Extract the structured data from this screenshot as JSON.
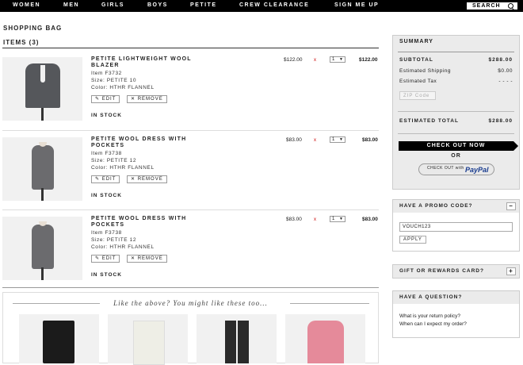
{
  "nav": {
    "items": [
      "WOMEN",
      "MEN",
      "GIRLS",
      "BOYS",
      "PETITE",
      "CREW CLEARANCE",
      "SIGN ME UP"
    ],
    "search_label": "SEARCH"
  },
  "page": {
    "title": "SHOPPING BAG",
    "items_label": "ITEMS (3)"
  },
  "items": [
    {
      "name": "PETITE LIGHTWEIGHT WOOL BLAZER",
      "item_no": "Item F3732",
      "size": "Size: PETITE 10",
      "color": "Color: HTHR FLANNEL",
      "price": "$122.00",
      "qty": "1",
      "total": "$122.00",
      "stock": "IN STOCK",
      "edit": "EDIT",
      "remove": "REMOVE",
      "image": "blazer"
    },
    {
      "name": "PETITE WOOL DRESS WITH POCKETS",
      "item_no": "Item F3738",
      "size": "Size: PETITE 12",
      "color": "Color: HTHR FLANNEL",
      "price": "$83.00",
      "qty": "1",
      "total": "$83.00",
      "stock": "IN STOCK",
      "edit": "EDIT",
      "remove": "REMOVE",
      "image": "dress"
    },
    {
      "name": "PETITE WOOL DRESS WITH POCKETS",
      "item_no": "Item F3738",
      "size": "Size: PETITE 12",
      "color": "Color: HTHR FLANNEL",
      "price": "$83.00",
      "qty": "1",
      "total": "$83.00",
      "stock": "IN STOCK",
      "edit": "EDIT",
      "remove": "REMOVE",
      "image": "dress"
    }
  ],
  "times_symbol": "x",
  "reco": {
    "title": "Like the above? You might like these too...",
    "colors": [
      "#1b1b1b",
      "#eeeee6",
      "#2a2a2a",
      "#e58a9a"
    ]
  },
  "summary": {
    "title": "SUMMARY",
    "subtotal_label": "SUBTOTAL",
    "subtotal": "$288.00",
    "shipping_label": "Estimated Shipping",
    "shipping": "$0.00",
    "tax_label": "Estimated Tax",
    "tax": "- - - -",
    "zip_placeholder": "ZIP Code",
    "total_label": "ESTIMATED TOTAL",
    "total": "$288.00",
    "checkout_label": "CHECK OUT NOW",
    "or_label": "OR",
    "paypal_pre": "CHECK OUT with",
    "paypal_brand": "PayPal"
  },
  "promo": {
    "title": "HAVE A PROMO CODE?",
    "toggle": "−",
    "code": "VOUCH123",
    "apply": "APPLY"
  },
  "gift": {
    "title": "GIFT OR REWARDS CARD?",
    "toggle": "+"
  },
  "question": {
    "title": "HAVE A QUESTION?",
    "links": [
      "What is your return policy?",
      "When can I expect my order?"
    ]
  }
}
